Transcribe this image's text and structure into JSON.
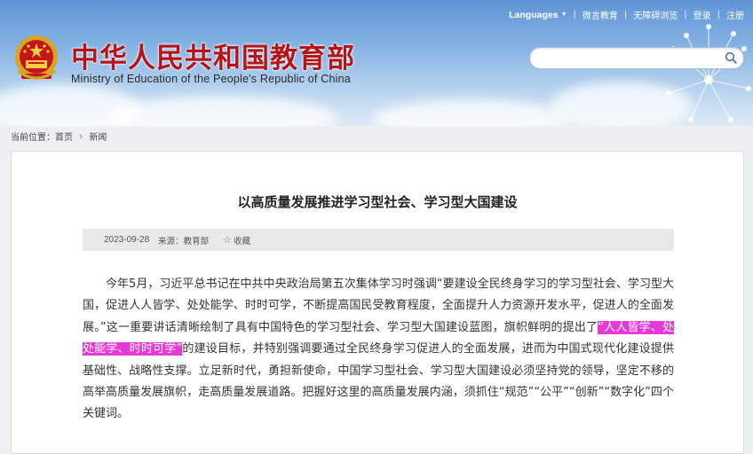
{
  "header": {
    "site_title": "中华人民共和国教育部",
    "site_subtitle": "Ministry of Education of the People's Republic of China",
    "nav": {
      "languages": "Languages",
      "weibo": "微言教育",
      "accessibility": "无障碍浏览",
      "login": "登录",
      "register": "注册"
    },
    "search": {
      "value": "",
      "placeholder": ""
    }
  },
  "breadcrumb": {
    "current_location": "当前位置：",
    "home": "首页",
    "news": "新闻"
  },
  "article": {
    "title": "以高质量发展推进学习型社会、学习型大国建设",
    "date": "2023-09-28",
    "source": "来源：教育部",
    "favorite": "收藏",
    "body_before": "今年5月，习近平总书记在中共中央政治局第五次集体学习时强调“要建设全民终身学习的学习型社会、学习型大国，促进人人皆学、处处能学、时时可学，不断提高国民受教育程度，全面提升人力资源开发水平，促进人的全面发展。”这一重要讲话清晰绘制了具有中国特色的学习型社会、学习型大国建设蓝图，旗帜鲜明的提出了",
    "body_highlight": "“人人皆学、处处能学、时时可学”",
    "body_after": "的建设目标，并特别强调要通过全民终身学习促进人的全面发展，进而为中国式现代化建设提供基础性、战略性支撑。立足新时代，勇担新使命，中国学习型社会、学习型大国建设必须坚持党的领导，坚定不移的高举高质量发展旗帜，走高质量发展道路。把握好这里的高质量发展内涵，须抓住“规范”“公平”“创新”“数字化”四个关键词。"
  },
  "colors": {
    "title_red": "#b3151b",
    "highlight_magenta": "#e63ad8",
    "sky_blue": "#5f95d6"
  },
  "icons": [
    "national-emblem-icon",
    "search-icon",
    "caret-down-icon",
    "chevron-right-icon",
    "star-icon"
  ]
}
